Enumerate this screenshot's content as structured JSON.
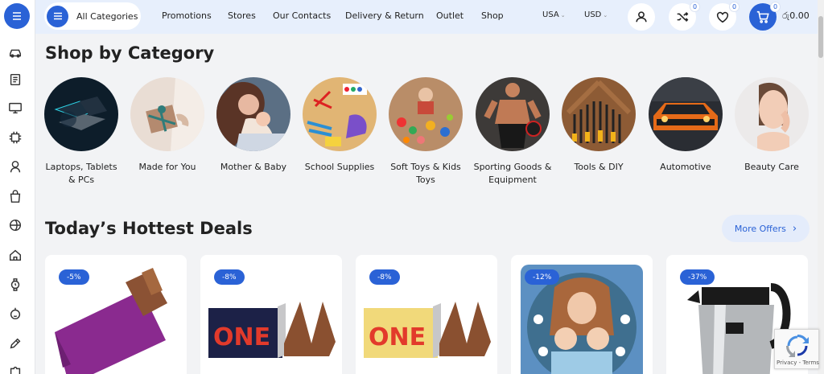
{
  "header": {
    "all_categories": "All Categories",
    "nav": [
      "Promotions",
      "Stores",
      "Our Contacts",
      "Delivery & Return",
      "Outlet",
      "Shop"
    ],
    "country": "USA",
    "currency": "USD",
    "compare_count": "0",
    "wishlist_count": "0",
    "cart_count": "0",
    "cart_total": "රු0.00"
  },
  "sidebar": {
    "icons": [
      "car-icon",
      "document-icon",
      "monitor-icon",
      "chip-icon",
      "baby-icon",
      "bag-icon",
      "ball-icon",
      "house-icon",
      "watch-icon",
      "face-icon",
      "pencil-icon",
      "puzzle-icon"
    ]
  },
  "categories_section": {
    "title": "Shop by Category",
    "items": [
      {
        "label": "Laptops, Tablets & PCs",
        "icon": "laptop-image"
      },
      {
        "label": "Made for You",
        "icon": "gift-image"
      },
      {
        "label": "Mother & Baby",
        "icon": "mother-baby-image"
      },
      {
        "label": "School Supplies",
        "icon": "school-supplies-image"
      },
      {
        "label": "Soft Toys & Kids Toys",
        "icon": "toys-image"
      },
      {
        "label": "Sporting Goods & Equipment",
        "icon": "sport-image"
      },
      {
        "label": "Tools & DIY",
        "icon": "tools-image"
      },
      {
        "label": "Automotive",
        "icon": "car-image"
      },
      {
        "label": "Beauty Care",
        "icon": "beauty-image"
      }
    ]
  },
  "deals_section": {
    "title": "Today’s Hottest Deals",
    "more_label": "More Offers",
    "products": [
      {
        "discount": "-5%",
        "image": "toblerone-purple-image"
      },
      {
        "discount": "-8%",
        "image": "toblerone-dark-image"
      },
      {
        "discount": "-8%",
        "image": "toblerone-white-image"
      },
      {
        "discount": "-12%",
        "image": "mother-children-art-image"
      },
      {
        "discount": "-37%",
        "image": "electric-kettle-image"
      }
    ]
  },
  "recaptcha": {
    "text": "Privacy - Terms"
  },
  "colors": {
    "accent": "#2a62d6",
    "header_bg": "#e7effc",
    "page_bg": "#f2f3f5"
  }
}
